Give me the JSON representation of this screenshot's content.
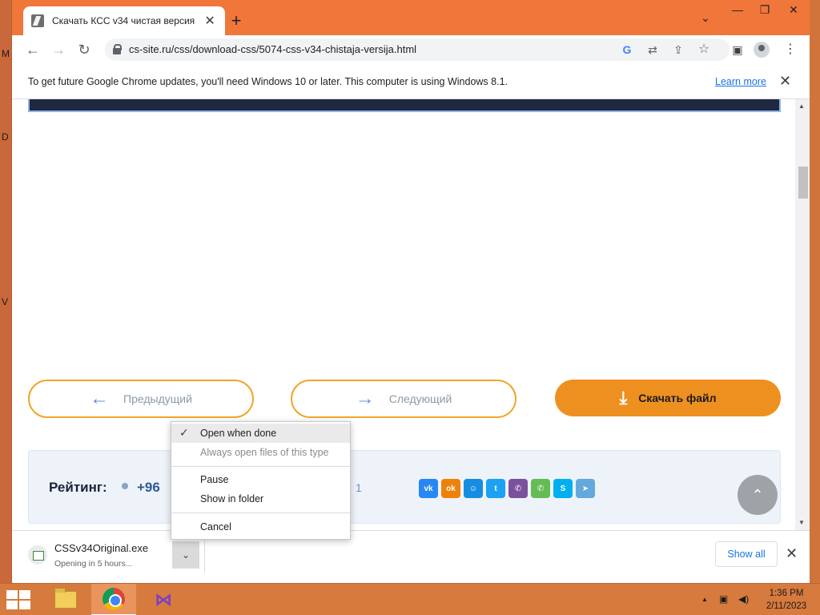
{
  "browser": {
    "tab_title": "Скачать КСС v34 чистая версия",
    "tab_close": "✕",
    "new_tab": "+",
    "tab_search": "⌄",
    "window_controls": {
      "minimize": "—",
      "restore": "❐",
      "close": "✕"
    },
    "nav": {
      "back": "←",
      "forward": "→",
      "reload": "↻"
    },
    "url": "cs-site.ru/css/download-css/5074-css-v34-chistaja-versija.html",
    "omnibox_icons": {
      "google": "G",
      "translate": "⇄",
      "share": "⇪",
      "bookmark": "☆"
    },
    "toolbar_icons": {
      "side_panel": "▣",
      "menu": "⋮"
    }
  },
  "infobar": {
    "message": "To get future Google Chrome updates, you'll need Windows 10 or later. This computer is using Windows 8.1.",
    "link": "Learn more",
    "close": "✕"
  },
  "page": {
    "prev_label": "Предыдущий",
    "prev_arrow": "←",
    "next_label": "Следующий",
    "next_arrow": "→",
    "download_label": "Скачать файл",
    "download_arrow": "⤓",
    "rating_label": "Рейтинг:",
    "rating_value": "+96",
    "rating_count": "1",
    "scroll_top": "⌃",
    "social": [
      {
        "name": "vk",
        "glyph": "vk",
        "color": "#2787f5"
      },
      {
        "name": "ok",
        "glyph": "ok",
        "color": "#ee8208"
      },
      {
        "name": "mymail",
        "glyph": "☺",
        "color": "#168de2"
      },
      {
        "name": "twitter",
        "glyph": "t",
        "color": "#1da1f2"
      },
      {
        "name": "viber",
        "glyph": "✆",
        "color": "#7b519d"
      },
      {
        "name": "whatsapp",
        "glyph": "✆",
        "color": "#65bc54"
      },
      {
        "name": "skype",
        "glyph": "S",
        "color": "#00aff0"
      },
      {
        "name": "telegram",
        "glyph": "➤",
        "color": "#64a9dc"
      }
    ]
  },
  "context_menu": {
    "items": [
      {
        "label": "Open when done",
        "checked": true,
        "disabled": false
      },
      {
        "label": "Always open files of this type",
        "checked": false,
        "disabled": true
      },
      {
        "label": "Pause",
        "checked": false,
        "disabled": false
      },
      {
        "label": "Show in folder",
        "checked": false,
        "disabled": false
      },
      {
        "label": "Cancel",
        "checked": false,
        "disabled": false
      }
    ],
    "check_glyph": "✓"
  },
  "download_bar": {
    "file_name": "CSSv34Original.exe",
    "status": "Opening in 5 hours...",
    "chevron": "⌄",
    "show_all": "Show all",
    "close": "✕"
  },
  "desktop": {
    "letters": [
      "M",
      "D",
      "V"
    ]
  },
  "taskbar": {
    "tray": {
      "up_arrow": "▲",
      "network": "▣",
      "volume": "◀)"
    },
    "time": "1:36 PM",
    "date": "2/11/2023",
    "vs_glyph": "⋈"
  }
}
